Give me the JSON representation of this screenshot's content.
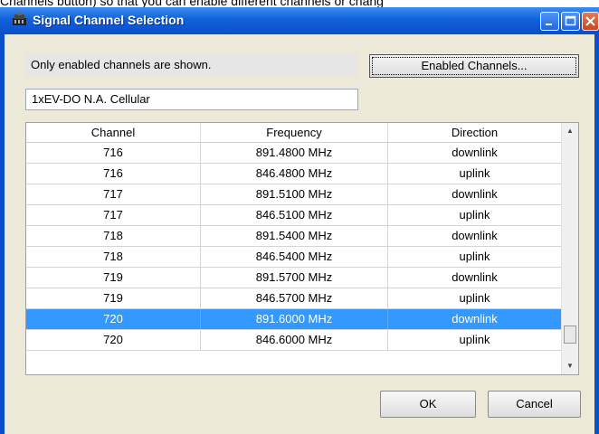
{
  "top_text": "Channels button) so that you can enable different channels or chang",
  "window": {
    "title": "Signal Channel Selection"
  },
  "info_text": "Only enabled channels are shown.",
  "enabled_button_label": "Enabled Channels...",
  "band_value": "1xEV-DO N.A. Cellular",
  "table": {
    "headers": [
      "Channel",
      "Frequency",
      "Direction"
    ],
    "rows": [
      {
        "channel": "716",
        "frequency": "891.4800 MHz",
        "direction": "downlink"
      },
      {
        "channel": "716",
        "frequency": "846.4800 MHz",
        "direction": "uplink"
      },
      {
        "channel": "717",
        "frequency": "891.5100 MHz",
        "direction": "downlink"
      },
      {
        "channel": "717",
        "frequency": "846.5100 MHz",
        "direction": "uplink"
      },
      {
        "channel": "718",
        "frequency": "891.5400 MHz",
        "direction": "downlink"
      },
      {
        "channel": "718",
        "frequency": "846.5400 MHz",
        "direction": "uplink"
      },
      {
        "channel": "719",
        "frequency": "891.5700 MHz",
        "direction": "downlink"
      },
      {
        "channel": "719",
        "frequency": "846.5700 MHz",
        "direction": "uplink"
      },
      {
        "channel": "720",
        "frequency": "891.6000 MHz",
        "direction": "downlink",
        "selected": true
      },
      {
        "channel": "720",
        "frequency": "846.6000 MHz",
        "direction": "uplink"
      }
    ]
  },
  "ok_label": "OK",
  "cancel_label": "Cancel",
  "colors": {
    "titlebar": "#0a4fc8",
    "selection": "#3399ff",
    "dialog_bg": "#ece9d8"
  }
}
